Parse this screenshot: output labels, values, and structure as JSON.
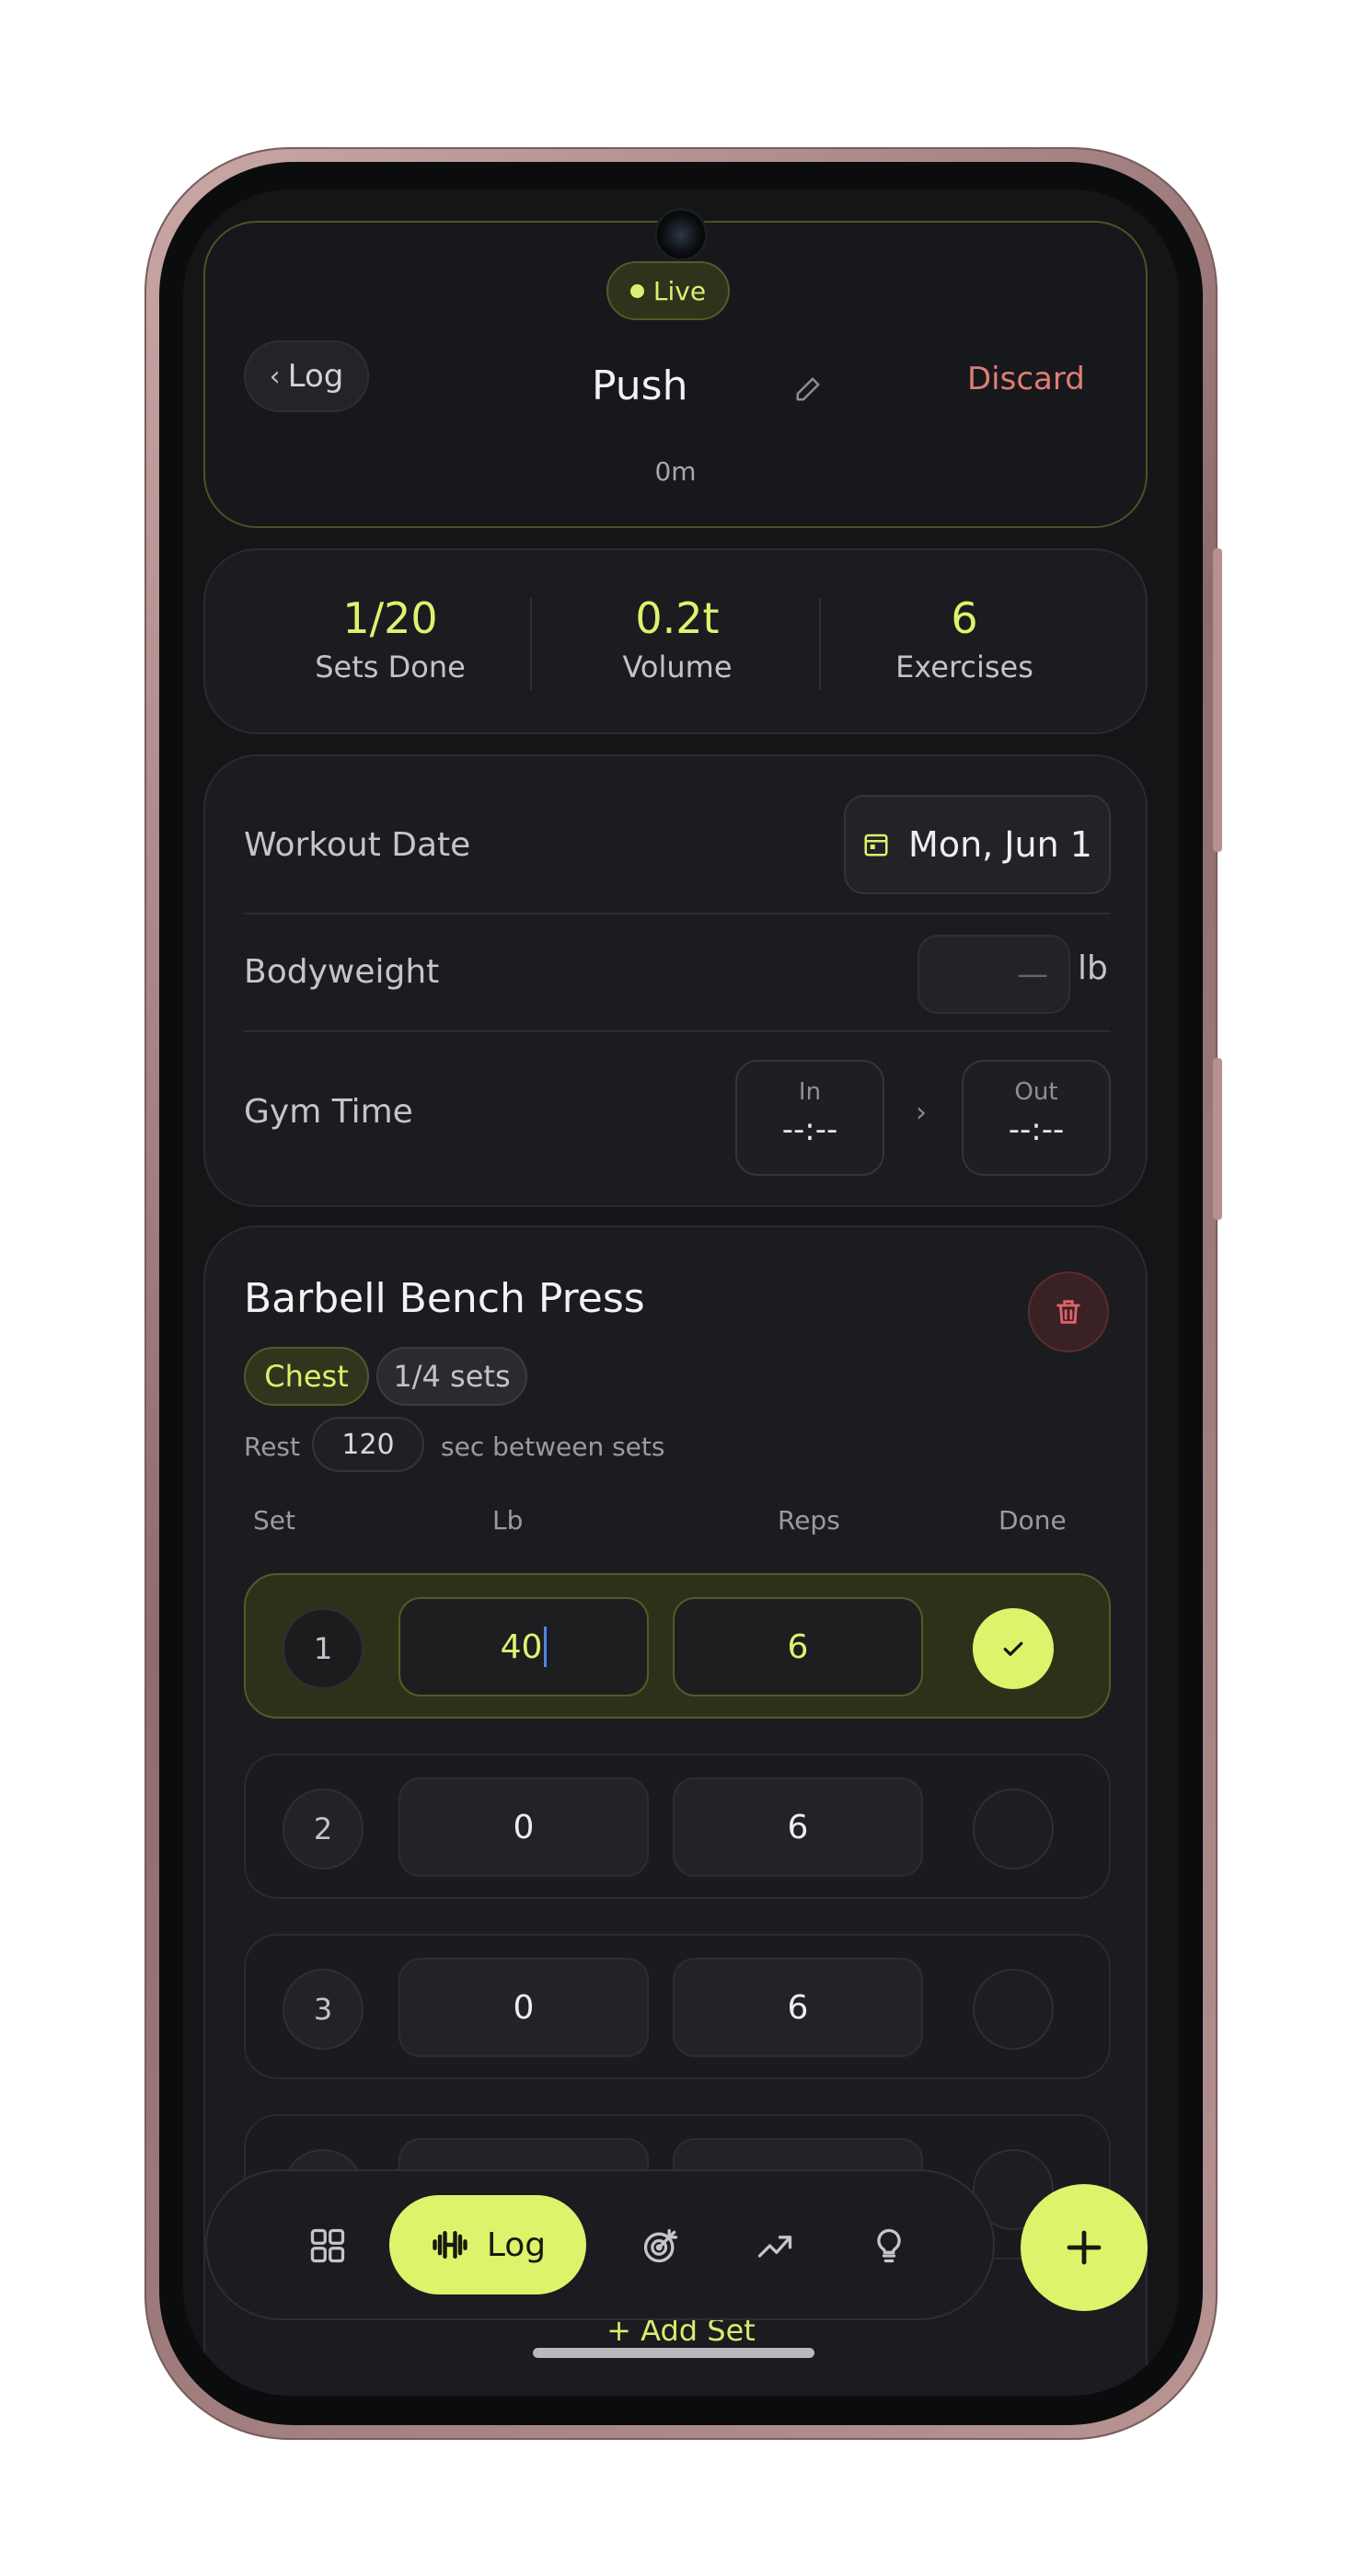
{
  "header": {
    "live_label": "Live",
    "back_label": "Log",
    "title": "Push",
    "discard_label": "Discard",
    "duration": "0m"
  },
  "stats": [
    {
      "value": "1/20",
      "label": "Sets Done"
    },
    {
      "value": "0.2t",
      "label": "Volume"
    },
    {
      "value": "6",
      "label": "Exercises"
    }
  ],
  "details": {
    "date_label": "Workout Date",
    "date_value": "Mon, Jun 1",
    "bodyweight_label": "Bodyweight",
    "bodyweight_placeholder": "—",
    "bodyweight_unit": "lb",
    "gym_time_label": "Gym Time",
    "in_label": "In",
    "in_value": "--:--",
    "out_label": "Out",
    "out_value": "--:--",
    "arrow": "›"
  },
  "exercise": {
    "name": "Barbell Bench Press",
    "muscle_tag": "Chest",
    "sets_tag": "1/4 sets",
    "rest_label": "Rest",
    "rest_seconds": "120",
    "rest_suffix": "sec between sets",
    "columns": {
      "set": "Set",
      "weight": "Lb",
      "reps": "Reps",
      "done": "Done"
    },
    "sets": [
      {
        "num": "1",
        "weight": "40",
        "reps": "6",
        "done": true
      },
      {
        "num": "2",
        "weight": "0",
        "reps": "6",
        "done": false
      },
      {
        "num": "3",
        "weight": "0",
        "reps": "6",
        "done": false
      }
    ],
    "add_set_label": "+ Add Set"
  },
  "nav": {
    "active_label": "Log",
    "items": [
      "dashboard-icon",
      "dumbbell-icon",
      "target-icon",
      "trending-up-icon",
      "lightbulb-icon"
    ]
  },
  "colors": {
    "accent": "#dcf46b",
    "danger": "#e27c76",
    "background": "#141517",
    "card": "#1b1c1f"
  }
}
